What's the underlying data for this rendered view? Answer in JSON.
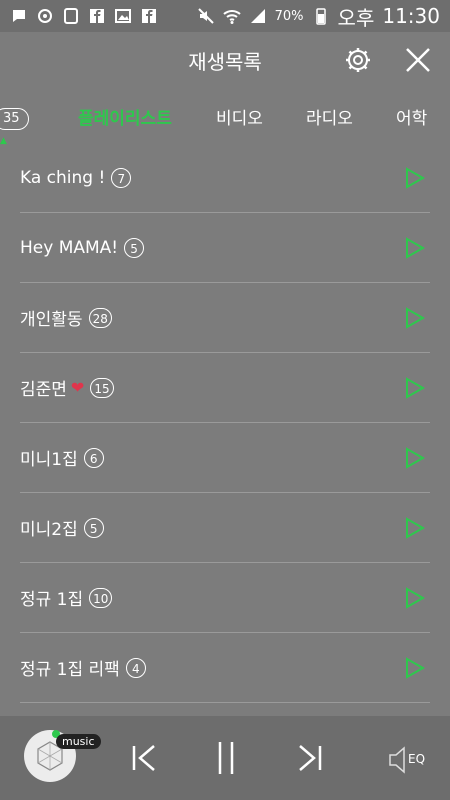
{
  "status": {
    "battery": "70%",
    "ampm": "오후",
    "time": "11:30",
    "icons": [
      "chat-icon",
      "mail-icon",
      "cast-icon",
      "facebook-icon",
      "gallery-icon",
      "facebook-icon",
      "mute-icon",
      "wifi-icon",
      "signal-icon",
      "battery-icon"
    ]
  },
  "header": {
    "title": "재생목록"
  },
  "tabs": {
    "count": "35",
    "items": [
      {
        "label": "플레이리스트",
        "active": true
      },
      {
        "label": "비디오",
        "active": false
      },
      {
        "label": "라디오",
        "active": false
      },
      {
        "label": "어학",
        "active": false
      }
    ]
  },
  "playlists": [
    {
      "name": "Ka ching !",
      "count": "7"
    },
    {
      "name": "Hey MAMA!",
      "count": "5"
    },
    {
      "name": "개인활동",
      "count": "28"
    },
    {
      "name": "김준면",
      "count": "15",
      "heart": true
    },
    {
      "name": "미니1집",
      "count": "6"
    },
    {
      "name": "미니2집",
      "count": "5"
    },
    {
      "name": "정규 1집",
      "count": "10"
    },
    {
      "name": "정규 1집 리팩",
      "count": "4"
    }
  ],
  "player": {
    "tag": "music",
    "eq_label": "EQ"
  },
  "colors": {
    "accent": "#2ec84d",
    "background": "#7c7c7c"
  }
}
